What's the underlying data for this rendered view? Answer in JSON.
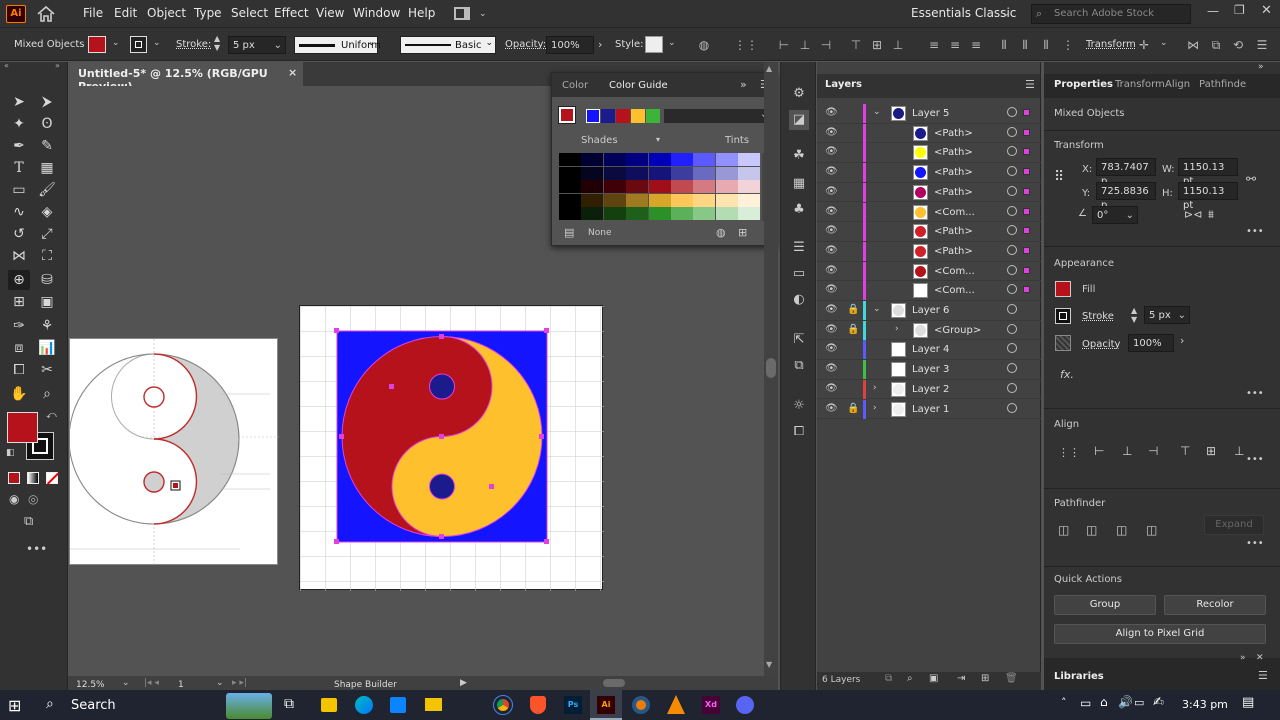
{
  "app": {
    "logo": "Ai"
  },
  "menu": [
    "File",
    "Edit",
    "Object",
    "Type",
    "Select",
    "Effect",
    "View",
    "Window",
    "Help"
  ],
  "workspace": {
    "name": "Essentials Classic",
    "search_placeholder": "Search Adobe Stock"
  },
  "control": {
    "selection": "Mixed Objects",
    "stroke_label": "Stroke:",
    "stroke_value": "5 px",
    "profile": "Uniform",
    "brush": "Basic",
    "opacity_label": "Opacity:",
    "opacity_value": "100%",
    "style_label": "Style:",
    "transform_label": "Transform",
    "fill_color": "#b5121b"
  },
  "document": {
    "tab": "Untitled-5* @ 12.5% (RGB/GPU Preview)",
    "close": "×"
  },
  "status": {
    "zoom": "12.5%",
    "artboard": "1",
    "tool": "Shape Builder"
  },
  "colorguide": {
    "tab_color": "Color",
    "tab_guide": "Color Guide",
    "shades": "Shades",
    "tints": "Tints",
    "none": "None",
    "harmony": [
      "#1414ff",
      "#1b1b8e",
      "#b5121b",
      "#ffc02e",
      "#3cb43c"
    ],
    "grid": [
      [
        "#000000",
        "#000033",
        "#00005a",
        "#000080",
        "#0000b8",
        "#2020ff",
        "#5a5aff",
        "#9090ff",
        "#c8c8ff"
      ],
      [
        "#000000",
        "#050520",
        "#0a0a3e",
        "#0e0e5c",
        "#14147a",
        "#3d3da0",
        "#6a6ac0",
        "#9898d6",
        "#c6c6ec"
      ],
      [
        "#000000",
        "#200004",
        "#400008",
        "#6a0a10",
        "#a00f17",
        "#c04a50",
        "#d47a80",
        "#e6aab0",
        "#f2d4d8"
      ],
      [
        "#000000",
        "#302000",
        "#604410",
        "#a07a20",
        "#d6a52a",
        "#ffc65a",
        "#ffd586",
        "#ffe4b0",
        "#fff2d8"
      ],
      [
        "#000000",
        "#0a2008",
        "#144010",
        "#1e601a",
        "#2c9028",
        "#5cb05a",
        "#88c886",
        "#b4dcb2",
        "#d8eed8"
      ]
    ]
  },
  "layers": {
    "title": "Layers",
    "count": "6 Layers",
    "rows": [
      {
        "name": "Layer 5",
        "indent": 0,
        "expanded": true,
        "color": "#e040e0",
        "thumb": "#1a1a80"
      },
      {
        "name": "<Path>",
        "indent": 1,
        "color": "#e040e0",
        "thumb": "#1b1b8e"
      },
      {
        "name": "<Path>",
        "indent": 1,
        "color": "#e040e0",
        "thumb": "#ffff00"
      },
      {
        "name": "<Path>",
        "indent": 1,
        "color": "#e040e0",
        "thumb": "#1414ff"
      },
      {
        "name": "<Path>",
        "indent": 1,
        "color": "#e040e0",
        "thumb": "#b00060"
      },
      {
        "name": "<Com...",
        "indent": 1,
        "color": "#e040e0",
        "thumb": "#ffc02e"
      },
      {
        "name": "<Path>",
        "indent": 1,
        "color": "#e040e0",
        "thumb": "#d0202a"
      },
      {
        "name": "<Path>",
        "indent": 1,
        "color": "#e040e0",
        "thumb": "#d0202a"
      },
      {
        "name": "<Com...",
        "indent": 1,
        "color": "#e040e0",
        "thumb": "#b5121b"
      },
      {
        "name": "<Com...",
        "indent": 1,
        "color": "#e040e0",
        "thumb": "#ffffff"
      },
      {
        "name": "Layer 6",
        "indent": 0,
        "expanded": true,
        "locked": true,
        "color": "#40d8d8",
        "thumb": "#dddddd"
      },
      {
        "name": "<Group>",
        "indent": 1,
        "locked": true,
        "color": "#40d8d8",
        "thumb": "#dddddd"
      },
      {
        "name": "Layer 4",
        "indent": 0,
        "color": "#5a5aff",
        "thumb": "#ffffff"
      },
      {
        "name": "Layer 3",
        "indent": 0,
        "color": "#40c040",
        "thumb": "#ffffff"
      },
      {
        "name": "Layer 2",
        "indent": 0,
        "collapsed": true,
        "color": "#e04040",
        "thumb": "#eeeeee"
      },
      {
        "name": "Layer 1",
        "indent": 0,
        "collapsed": true,
        "locked": true,
        "color": "#5a5aff",
        "thumb": "#eeeeee"
      }
    ]
  },
  "properties": {
    "tabs": [
      "Properties",
      "Transform",
      "Align",
      "Pathfinde"
    ],
    "selection": "Mixed Objects",
    "transform_title": "Transform",
    "x_label": "X:",
    "x": "783.7407 p",
    "y_label": "Y:",
    "y": "725.8836 p",
    "w_label": "W:",
    "w": "1150.13 pt",
    "h_label": "H:",
    "h": "1150.13 pt",
    "angle": "0°",
    "appearance_title": "Appearance",
    "fill_label": "Fill",
    "stroke_label": "Stroke",
    "stroke_value": "5 px",
    "opacity_label": "Opacity",
    "opacity_value": "100%",
    "fx": "fx.",
    "align_title": "Align",
    "pathfinder_title": "Pathfinder",
    "expand": "Expand",
    "quick_title": "Quick Actions",
    "group_btn": "Group",
    "recolor_btn": "Recolor",
    "align_grid_btn": "Align to Pixel Grid",
    "libraries": "Libraries"
  },
  "taskbar": {
    "search": "Search",
    "time": "3:43 pm"
  }
}
